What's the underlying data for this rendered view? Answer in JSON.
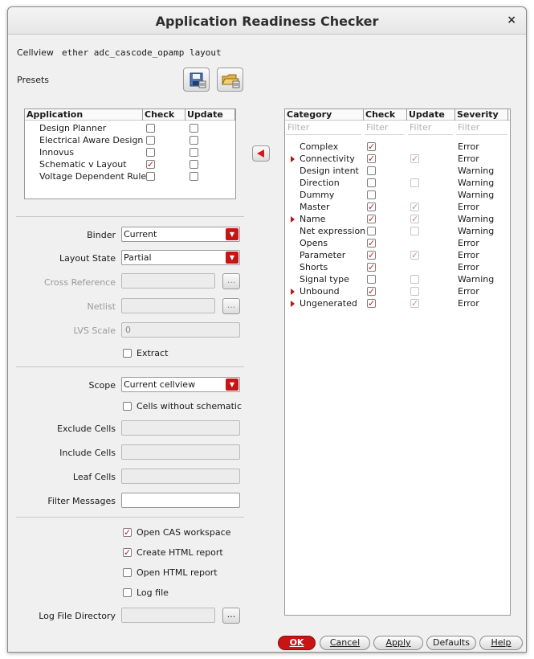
{
  "window": {
    "title": "Application Readiness Checker",
    "close_glyph": "×"
  },
  "cellview": {
    "label": "Cellview",
    "value": "ether adc_cascode_opamp layout"
  },
  "presets": {
    "label": "Presets",
    "save_icon": "save-preset-icon",
    "load_icon": "open-preset-icon"
  },
  "app_table": {
    "headers": [
      "Application",
      "Check",
      "Update"
    ],
    "rows": [
      {
        "name": "Design Planner",
        "check": false,
        "update": false
      },
      {
        "name": "Electrical Aware Design",
        "check": false,
        "update": false
      },
      {
        "name": "Innovus",
        "check": false,
        "update": false
      },
      {
        "name": "Schematic v Layout",
        "check": true,
        "update": false
      },
      {
        "name": "Voltage Dependent Rule",
        "check": false,
        "update": false
      }
    ]
  },
  "transfer_icon": "left-arrow-icon",
  "form": {
    "binder": {
      "label": "Binder",
      "value": "Current"
    },
    "layout_state": {
      "label": "Layout State",
      "value": "Partial"
    },
    "cross_reference": {
      "label": "Cross Reference",
      "value": ""
    },
    "netlist": {
      "label": "Netlist",
      "value": ""
    },
    "lvs_scale": {
      "label": "LVS Scale",
      "value": "0"
    },
    "extract": {
      "label": "Extract",
      "checked": false
    },
    "scope": {
      "label": "Scope",
      "value": "Current cellview"
    },
    "cells_without_schematic": {
      "label": "Cells without schematic",
      "checked": false
    },
    "exclude_cells": {
      "label": "Exclude Cells",
      "value": ""
    },
    "include_cells": {
      "label": "Include Cells",
      "value": ""
    },
    "leaf_cells": {
      "label": "Leaf Cells",
      "value": ""
    },
    "filter_messages": {
      "label": "Filter Messages",
      "value": ""
    },
    "open_cas": {
      "label": "Open CAS workspace",
      "checked": true
    },
    "create_html": {
      "label": "Create HTML report",
      "checked": true
    },
    "open_html": {
      "label": "Open HTML report",
      "checked": false
    },
    "log_file": {
      "label": "Log file",
      "checked": false
    },
    "log_dir": {
      "label": "Log File Directory",
      "value": ""
    },
    "browse_label": "..."
  },
  "cat_table": {
    "headers": [
      "Category",
      "Check",
      "Update",
      "Severity"
    ],
    "filter_placeholder": "Filter",
    "rows": [
      {
        "name": "Complex",
        "expandable": false,
        "check": true,
        "update": null,
        "severity": "Error"
      },
      {
        "name": "Connectivity",
        "expandable": true,
        "check": true,
        "update": true,
        "severity": "Error"
      },
      {
        "name": "Design intent",
        "expandable": false,
        "check": false,
        "update": null,
        "severity": "Warning"
      },
      {
        "name": "Direction",
        "expandable": false,
        "check": false,
        "update": false,
        "severity": "Warning"
      },
      {
        "name": "Dummy",
        "expandable": false,
        "check": false,
        "update": null,
        "severity": "Warning"
      },
      {
        "name": "Master",
        "expandable": false,
        "check": true,
        "update": true,
        "severity": "Error"
      },
      {
        "name": "Name",
        "expandable": true,
        "check": true,
        "update": true,
        "severity": "Warning"
      },
      {
        "name": "Net expression",
        "expandable": false,
        "check": false,
        "update": false,
        "severity": "Warning"
      },
      {
        "name": "Opens",
        "expandable": false,
        "check": true,
        "update": null,
        "severity": "Error"
      },
      {
        "name": "Parameter",
        "expandable": false,
        "check": true,
        "update": true,
        "severity": "Error"
      },
      {
        "name": "Shorts",
        "expandable": false,
        "check": true,
        "update": null,
        "severity": "Error"
      },
      {
        "name": "Signal type",
        "expandable": false,
        "check": false,
        "update": false,
        "severity": "Warning"
      },
      {
        "name": "Unbound",
        "expandable": true,
        "check": true,
        "update": false,
        "severity": "Error"
      },
      {
        "name": "Ungenerated",
        "expandable": true,
        "check": true,
        "update": true,
        "severity": "Error"
      }
    ]
  },
  "buttons": {
    "ok": "OK",
    "cancel": "Cancel",
    "apply": "Apply",
    "defaults": "Defaults",
    "help": "Help"
  },
  "colors": {
    "accent": "#c81414",
    "check": "#c01b1b"
  }
}
